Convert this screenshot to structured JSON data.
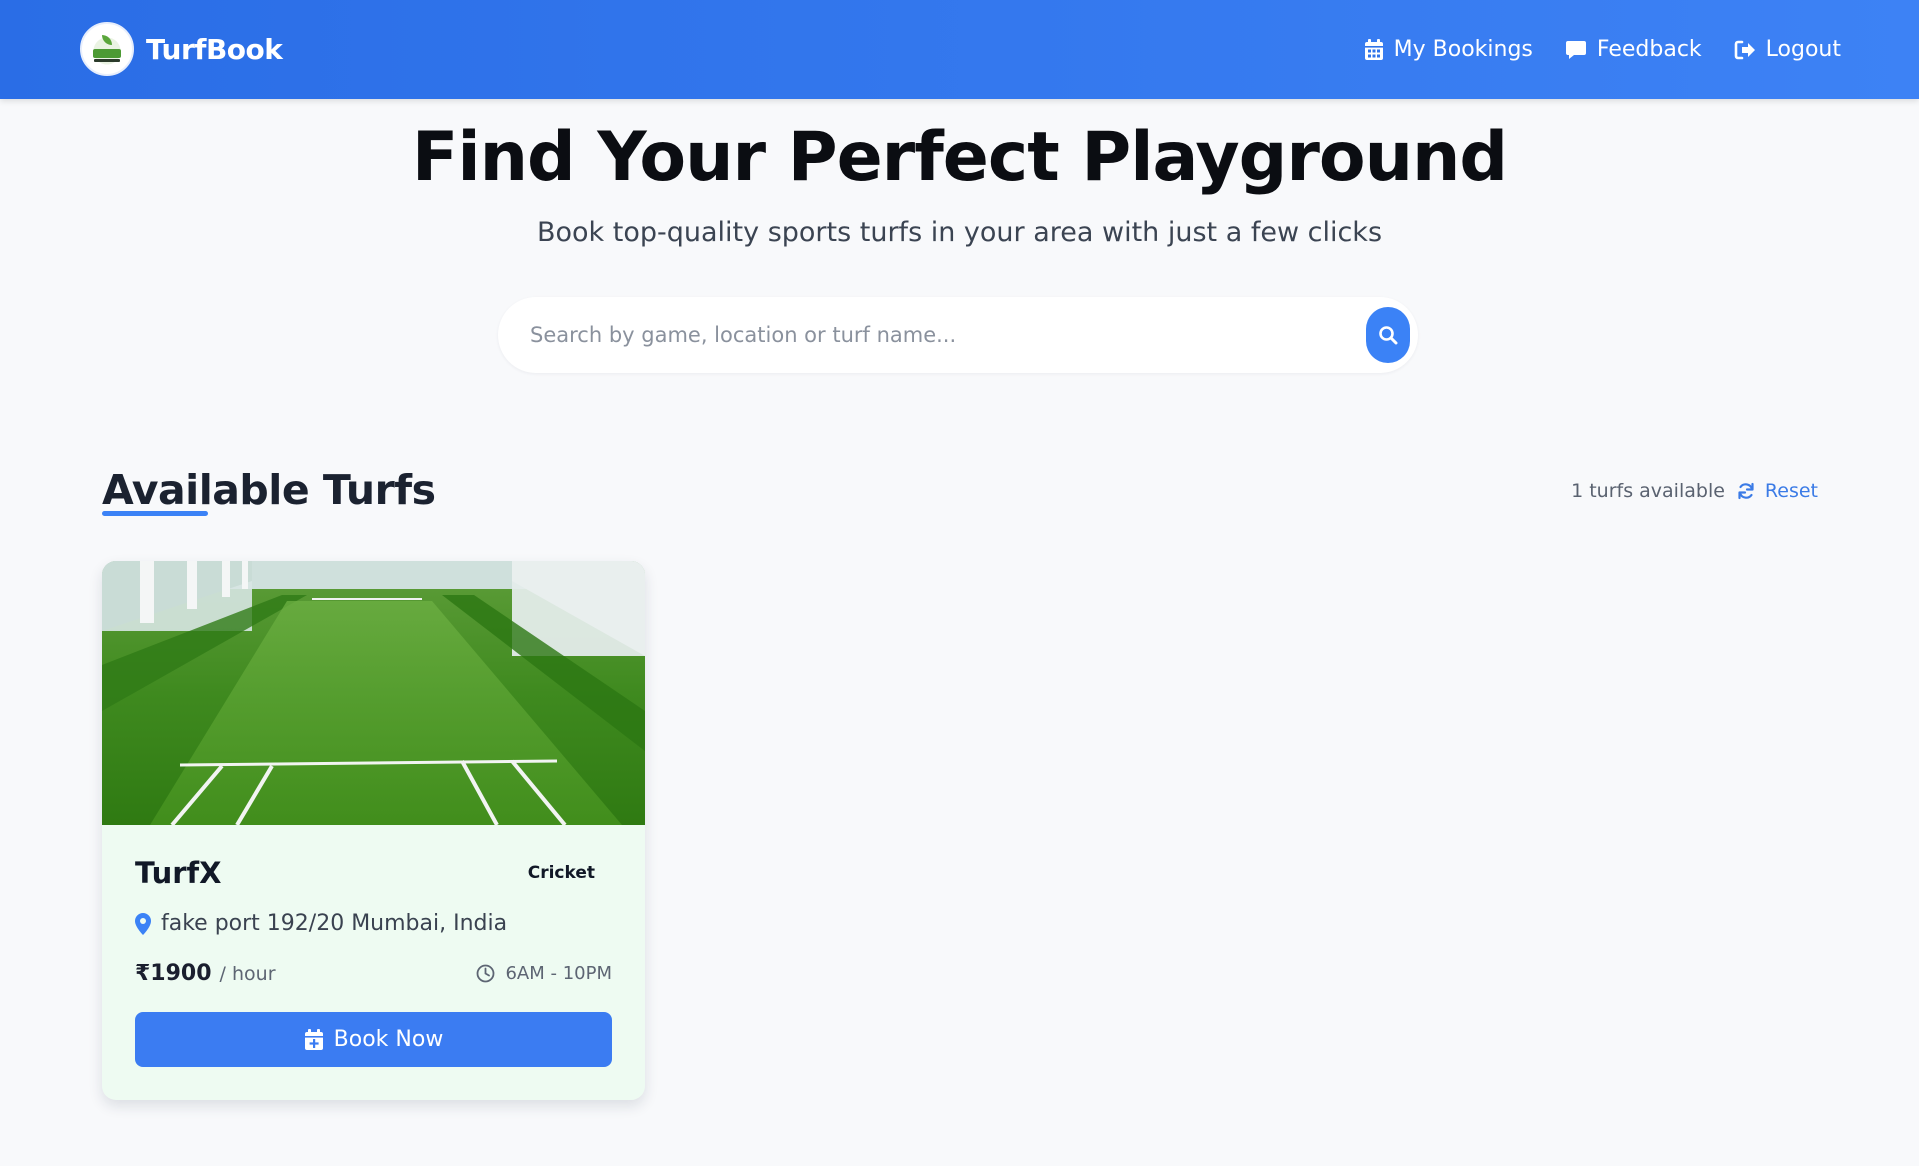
{
  "navbar": {
    "brand": "TurfBook",
    "links": [
      {
        "label": "My Bookings",
        "icon": "calendar-icon"
      },
      {
        "label": "Feedback",
        "icon": "comment-icon"
      },
      {
        "label": "Logout",
        "icon": "logout-icon"
      }
    ]
  },
  "hero": {
    "title": "Find Your Perfect Playground",
    "subtitle": "Book top-quality sports turfs in your area with just a few clicks",
    "search_placeholder": "Search by game, location or turf name..."
  },
  "section": {
    "title": "Available Turfs",
    "count_text": "1 turfs available",
    "reset_label": "Reset"
  },
  "turfs": [
    {
      "name": "TurfX",
      "sport": "Cricket",
      "location": "fake port 192/20 Mumbai, India",
      "price": "₹1900",
      "price_unit": "/ hour",
      "hours": "6AM - 10PM",
      "book_label": "Book Now"
    }
  ],
  "colors": {
    "primary": "#3b82f6",
    "nav_gradient_start": "#2a6de6",
    "nav_gradient_end": "#3d82f5",
    "card_bg": "#eefbf2",
    "page_bg": "#f8f9fb"
  }
}
